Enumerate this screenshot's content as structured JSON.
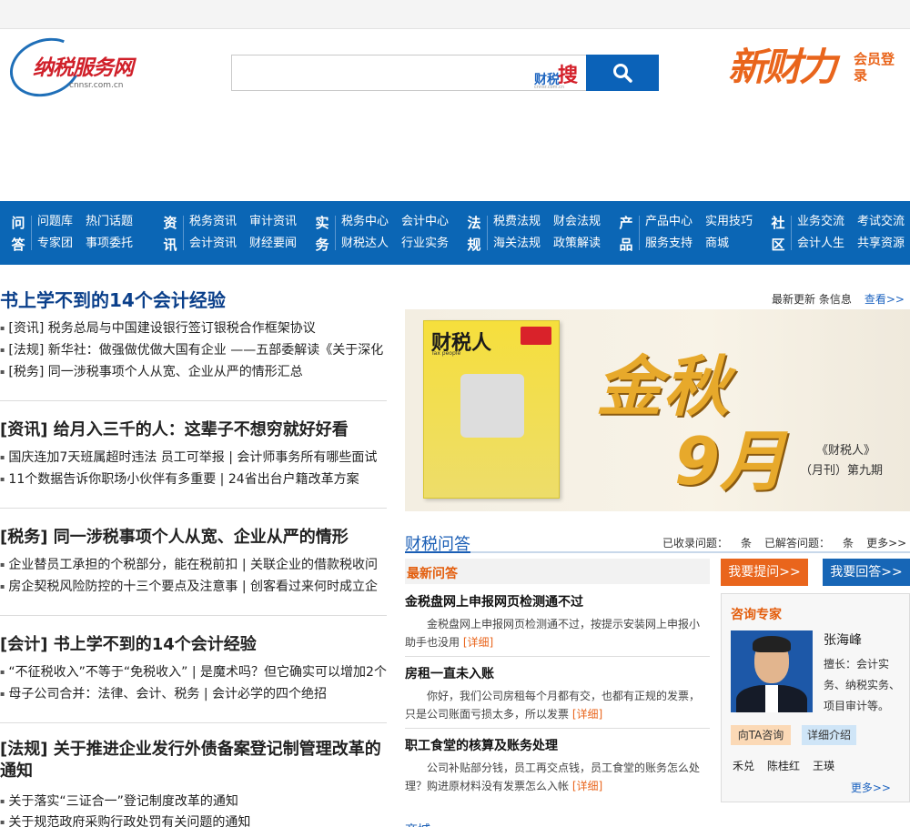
{
  "header": {
    "logo_text": "纳税服务网",
    "logo_sub": "cnnsr.com.cn",
    "search": {
      "placeholder": "",
      "brand_a": "财税",
      "brand_b": "搜",
      "brand_c": "cnnsr.com.cn"
    },
    "promo_text": "新财力",
    "login_text": "会员登录"
  },
  "nav": [
    {
      "head": "问答",
      "items": [
        "问题库",
        "热门话题",
        "专家团",
        "事项委托"
      ]
    },
    {
      "head": "资讯",
      "items": [
        "税务资讯",
        "审计资讯",
        "会计资讯",
        "财经要闻"
      ]
    },
    {
      "head": "实务",
      "items": [
        "税务中心",
        "会计中心",
        "财税达人",
        "行业实务"
      ]
    },
    {
      "head": "法规",
      "items": [
        "税费法规",
        "财会法规",
        "海关法规",
        "政策解读"
      ]
    },
    {
      "head": "产品",
      "items": [
        "产品中心",
        "实用技巧",
        "服务支持",
        "商城"
      ]
    },
    {
      "head": "社区",
      "items": [
        "业务交流",
        "考试交流",
        "会计人生",
        "共享资源"
      ]
    }
  ],
  "meta": {
    "text": "最新更新 条信息",
    "more": "查看>>"
  },
  "news": [
    {
      "headline": "书上学不到的14个会计经验",
      "rows": [
        "[资讯] 税务总局与中国建设银行签订银税合作框架协议",
        "[法规] 新华社：做强做优做大国有企业 ——五部委解读《关于深化",
        "[税务] 同一涉税事项个人从宽、企业从严的情形汇总"
      ]
    },
    {
      "headline": "[资讯] 给月入三千的人：这辈子不想穷就好好看",
      "rows": [
        "国庆连加7天班属超时违法 员工可举报 | 会计师事务所有哪些面试",
        "11个数据告诉你职场小伙伴有多重要 | 24省出台户籍改革方案"
      ]
    },
    {
      "headline": "[税务] 同一涉税事项个人从宽、企业从严的情形",
      "rows": [
        "企业替员工承担的个税部分，能在税前扣 | 关联企业的借款税收问",
        "房企契税风险防控的十三个要点及注意事 | 创客看过来何时成立企"
      ]
    },
    {
      "headline": "[会计] 书上学不到的14个会计经验",
      "rows": [
        "“不征税收入”不等于“免税收入” | 是魔术吗？但它确实可以增加2个",
        "母子公司合并：法律、会计、税务 | 会计必学的四个绝招"
      ]
    },
    {
      "headline": "[法规] 关于推进企业发行外债备案登记制管理改革的通知",
      "rows": [
        "关于落实“三证合一”登记制度改革的通知",
        "关于规范政府采购行政处罚有关问题的通知"
      ]
    }
  ],
  "banner": {
    "mag_title": "财税人",
    "mag_sub": "Tax people",
    "big1": "金秋",
    "big2": "9月",
    "cap1": "《财税人》",
    "cap2": "（月刊）第九期"
  },
  "qa": {
    "title": "财税问答",
    "stats": [
      "已收录问题：",
      "条",
      "已解答问题：",
      "条",
      "更多>>"
    ],
    "latest_label": "最新问答",
    "ask_btn": "我要提问>>",
    "answer_btn": "我要回答>>",
    "items": [
      {
        "title": "金税盘网上申报网页检测通不过",
        "desc": "金税盘网上申报网页检测通不过，按提示安装网上申报小助手也没用",
        "detail": "[详细]"
      },
      {
        "title": "房租一直未入账",
        "desc": "你好，我们公司房租每个月都有交，也都有正规的发票，只是公司账面亏损太多，所以发票",
        "detail": "[详细]"
      },
      {
        "title": "职工食堂的核算及账务处理",
        "desc": "公司补贴部分钱，员工再交点钱，员工食堂的账务怎么处理？购进原材料没有发票怎么入帐",
        "detail": "[详细]"
      }
    ]
  },
  "expert": {
    "title": "咨询专家",
    "name": "张海峰",
    "desc": "擅长：会计实务、纳税实务、项目审计等。",
    "btn_ask": "向TA咨询",
    "btn_detail": "详细介绍",
    "others": [
      "禾兑",
      "陈桂红",
      "王瑛"
    ],
    "more": "更多>>"
  },
  "cut_text": "商城"
}
